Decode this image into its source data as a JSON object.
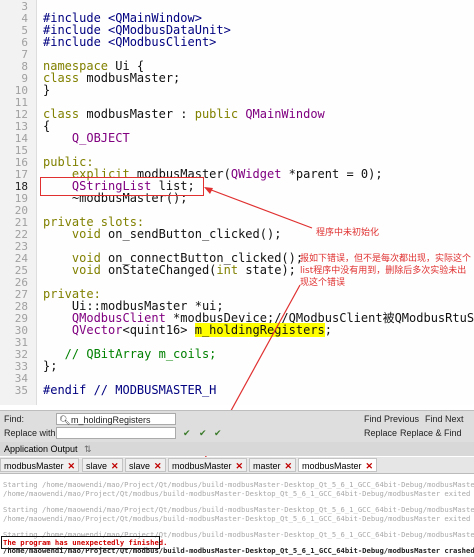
{
  "editor": {
    "line_numbers": [
      "3",
      "4",
      "5",
      "6",
      "7",
      "8",
      "9",
      "10",
      "11",
      "12",
      "13",
      "14",
      "15",
      "16",
      "17",
      "18",
      "19",
      "20",
      "21",
      "22",
      "23",
      "24",
      "25",
      "26",
      "27",
      "28",
      "29",
      "30",
      "31",
      "32",
      "33",
      "34",
      "35"
    ],
    "current_line": "18",
    "lines": [
      "",
      "#include <QMainWindow>",
      "#include <QModbusDataUnit>",
      "#include <QModbusClient>",
      "",
      "namespace Ui {",
      "class modbusMaster;",
      "}",
      "",
      "class modbusMaster : public QMainWindow",
      "{",
      "    Q_OBJECT",
      "",
      "public:",
      "    explicit modbusMaster(QWidget *parent = 0);",
      "    QStringList list;",
      "    ~modbusMaster();",
      "",
      "private slots:",
      "    void on_sendButton_clicked();",
      "",
      "    void on_connectButton_clicked();",
      "    void onStateChanged(int state);",
      "",
      "private:",
      "    Ui::modbusMaster *ui;",
      "    QModbusClient *modbusDevice;//QModbusClient被QModbusRtuSerialMaster",
      "    QVector<quint16> m_holdingRegisters;",
      "",
      "   // QBitArray m_coils;",
      "};",
      "",
      "#endif // MODBUSMASTER_H"
    ]
  },
  "annotations": {
    "note1": "程序中未初始化",
    "note2": "报如下错误，但不是每次都出现，实际这个list程序中没有用到，删除后多次实验未出现这个错误"
  },
  "find": {
    "find_label": "Find:",
    "find_value": "m_holdingRegisters",
    "replace_label": "Replace with:",
    "find_previous": "Find Previous",
    "find_next": "Find Next",
    "replace": "Replace",
    "replace_find": "Replace & Find"
  },
  "output_pane": {
    "title": "Application Output",
    "tabs": [
      "modbusMaster",
      "slave",
      "slave",
      "modbusMaster",
      "master",
      "modbusMaster"
    ],
    "lines": [
      "Starting /home/maowendi/mao/Project/Qt/modbus/build-modbusMaster-Desktop_Qt_5_6_1_GCC_64bit-Debug/modbusMaster...",
      "/home/maowendi/mao/Project/Qt/modbus/build-modbusMaster-Desktop_Qt_5_6_1_GCC_64bit-Debug/modbusMaster exited with",
      "",
      "Starting /home/maowendi/mao/Project/Qt/modbus/build-modbusMaster-Desktop_Qt_5_6_1_GCC_64bit-Debug/modbusMaster...",
      "/home/maowendi/mao/Project/Qt/modbus/build-modbusMaster-Desktop_Qt_5_6_1_GCC_64bit-Debug/modbusMaster exited with",
      "",
      "Starting /home/maowendi/mao/Project/Qt/modbus/build-modbusMaster-Desktop_Qt_5_6_1_GCC_64bit-Debug/modbusMaster...",
      "The program has unexpectedly finished.",
      "/home/maowendi/mao/Project/Qt/modbus/build-modbusMaster-Desktop_Qt_5_6_1_GCC_64bit-Debug/modbusMaster crashed."
    ]
  },
  "colors": {
    "annotation_red": "#e03030",
    "highlight_yellow": "#ffff00",
    "keyword": "#808000",
    "class": "#800080",
    "comment": "#008000"
  }
}
